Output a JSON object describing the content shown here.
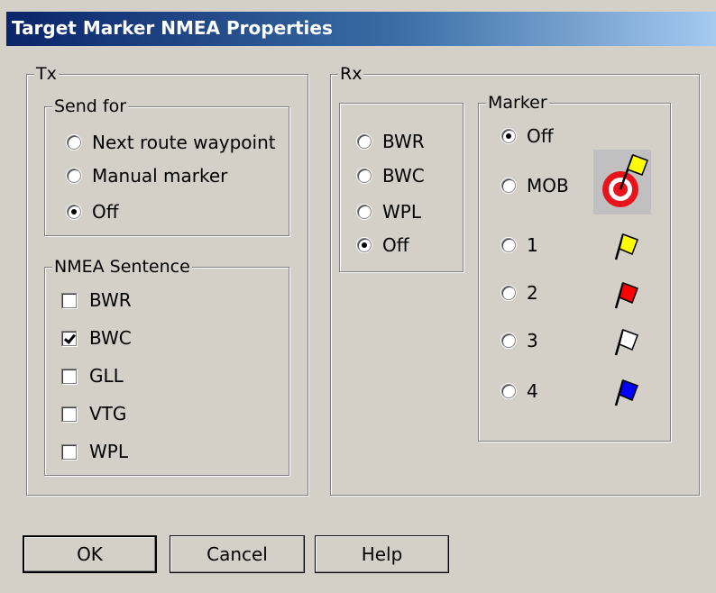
{
  "window": {
    "title": "Target Marker NMEA Properties"
  },
  "tx": {
    "label": "Tx",
    "send_for": {
      "label": "Send for",
      "options": [
        {
          "label": "Next route waypoint",
          "checked": false
        },
        {
          "label": "Manual marker",
          "checked": false
        },
        {
          "label": "Off",
          "checked": true
        }
      ]
    },
    "nmea_sentence": {
      "label": "NMEA Sentence",
      "items": [
        {
          "label": "BWR",
          "checked": false
        },
        {
          "label": "BWC",
          "checked": true
        },
        {
          "label": "GLL",
          "checked": false
        },
        {
          "label": "VTG",
          "checked": false
        },
        {
          "label": "WPL",
          "checked": false
        }
      ]
    }
  },
  "rx": {
    "label": "Rx",
    "sentences": [
      {
        "label": "BWR",
        "checked": false
      },
      {
        "label": "BWC",
        "checked": false
      },
      {
        "label": "WPL",
        "checked": false
      },
      {
        "label": "Off",
        "checked": true
      }
    ],
    "marker": {
      "label": "Marker",
      "options": [
        {
          "label": "Off",
          "checked": true,
          "icon": null
        },
        {
          "label": "MOB",
          "checked": false,
          "icon": "mob-target-icon",
          "flag_color": "#ffff00"
        },
        {
          "label": "1",
          "checked": false,
          "icon": "yellow-flag-icon",
          "flag_color": "#ffff00"
        },
        {
          "label": "2",
          "checked": false,
          "icon": "red-flag-icon",
          "flag_color": "#ff0000"
        },
        {
          "label": "3",
          "checked": false,
          "icon": "white-flag-icon",
          "flag_color": "#ffffff"
        },
        {
          "label": "4",
          "checked": false,
          "icon": "blue-flag-icon",
          "flag_color": "#0000ff"
        }
      ]
    }
  },
  "buttons": {
    "ok": "OK",
    "cancel": "Cancel",
    "help": "Help"
  }
}
